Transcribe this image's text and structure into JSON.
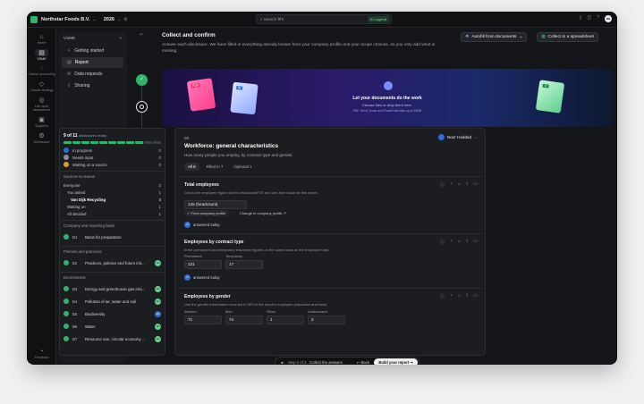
{
  "app": {
    "org": "Northstar Foods B.V.",
    "year": "2026",
    "search_placeholder": "Search  ⌘K",
    "ai_badge": "AI Legend",
    "user_initials": "NH"
  },
  "rail": [
    {
      "label": "Home",
      "icon": "home-icon",
      "glyph": "⌂"
    },
    {
      "label": "VSME",
      "icon": "vsme-icon",
      "glyph": "▤"
    },
    {
      "label": "Carbon accounting",
      "icon": "carbon-icon",
      "glyph": "◌"
    },
    {
      "label": "Climate strategy",
      "icon": "strategy-icon",
      "glyph": "◇"
    },
    {
      "label": "Life cycle assessment",
      "icon": "lca-icon",
      "glyph": "◎"
    },
    {
      "label": "Suppliers",
      "icon": "suppliers-icon",
      "glyph": "▣"
    },
    {
      "label": "Workspace",
      "icon": "workspace-icon",
      "glyph": "⚙"
    }
  ],
  "rail_bottom": {
    "label": "Feedback",
    "glyph": "◔"
  },
  "sidebar": {
    "title": "VSME",
    "items": [
      {
        "label": "Getting started",
        "glyph": "✧"
      },
      {
        "label": "Report",
        "glyph": "▤"
      },
      {
        "label": "Data requests",
        "glyph": "✉"
      },
      {
        "label": "Sharing",
        "glyph": "⇪"
      }
    ]
  },
  "steps": {
    "counter": "2/3"
  },
  "header": {
    "title": "Collect and confirm",
    "subtitle": "Answer each disclosure. We have filled in everything already known from your company profile and your scope choices, so you only add what is missing.",
    "autofill": "Autofill from documents",
    "spreadsheet": "Collect in a spreadsheet"
  },
  "banner": {
    "title": "Let your documents do the work",
    "subtitle": "Choose files or drop them here.",
    "fine": "PDF, Word, Excel and PowerPoint files up to 25MB"
  },
  "progress": {
    "title": "9 of 11",
    "suffix": "disclosures ready",
    "legend": [
      {
        "label": "In progress",
        "value": "0",
        "color": "#2d6fd8"
      },
      {
        "label": "Needs input",
        "value": "0",
        "color": "#8a8f97"
      },
      {
        "label": "Waiting on a source",
        "value": "0",
        "color": "#d9a12b"
      }
    ],
    "sources_title": "Sources to review",
    "sources": [
      {
        "label": "Everyone",
        "value": "3",
        "indent": 0
      },
      {
        "label": "You asked",
        "value": "1",
        "indent": 1
      },
      {
        "label": "Van Dijk Recycling",
        "value": "3",
        "indent": 2
      },
      {
        "label": "Waiting on",
        "value": "1",
        "indent": 1
      },
      {
        "label": "All decided",
        "value": "1",
        "indent": 1
      }
    ],
    "groups": [
      {
        "title": "Company and reporting basis",
        "items": [
          {
            "code": "B1",
            "label": "Basis for preparation",
            "av": ""
          }
        ]
      },
      {
        "title": "Policies and practices",
        "items": [
          {
            "code": "B2",
            "label": "Practices, policies and future init...",
            "av": "NH"
          }
        ]
      },
      {
        "title": "Environment",
        "items": [
          {
            "code": "B3",
            "label": "Energy and greenhouse gas emi...",
            "av": "NH"
          },
          {
            "code": "B4",
            "label": "Pollution of air, water and soil",
            "av": "NH"
          },
          {
            "code": "B5",
            "label": "Biodiversity",
            "av": "VD"
          },
          {
            "code": "B6",
            "label": "Water",
            "av": "NH"
          },
          {
            "code": "B7",
            "label": "Resource use, circular economy ...",
            "av": "NH"
          }
        ]
      }
    ]
  },
  "disclosure": {
    "code": "B8",
    "title": "Workforce: general characteristics",
    "desc": "How many people you employ, by contract type and gender.",
    "assignee": "Noor Haddad",
    "filters": [
      {
        "label": "All",
        "count": "8"
      },
      {
        "label": "Filled in",
        "count": "7"
      },
      {
        "label": "Optional",
        "count": "1"
      }
    ],
    "questions": [
      {
        "title": "Total employees",
        "desc": "Check the employee figure and its headcount/FTE and one-liner basis for this report.",
        "value": "145 (headcount)",
        "source": "From company profile",
        "link": "Change in company profile ↗",
        "answered": "answered today",
        "who": "JT"
      },
      {
        "title": "Employees by contract type",
        "desc": "Enter permanent and temporary employee figures on the same basis as the employee total.",
        "fields": [
          {
            "label": "Permanent",
            "value": "131"
          },
          {
            "label": "Temporary",
            "value": "17"
          }
        ],
        "answered": "answered today",
        "who": "JT"
      },
      {
        "title": "Employees by gender",
        "desc": "Use the gender information recorded in HR for the report's employee population and basis.",
        "fields": [
          {
            "label": "Women",
            "value": "71"
          },
          {
            "label": "Men",
            "value": "74"
          },
          {
            "label": "Other",
            "value": "1"
          },
          {
            "label": "Undisclosed",
            "value": "2"
          }
        ]
      }
    ]
  },
  "footer": {
    "step": "Step 2 of 3",
    "stepname": "Collect the answers",
    "back": "Back",
    "build": "Build your report"
  }
}
